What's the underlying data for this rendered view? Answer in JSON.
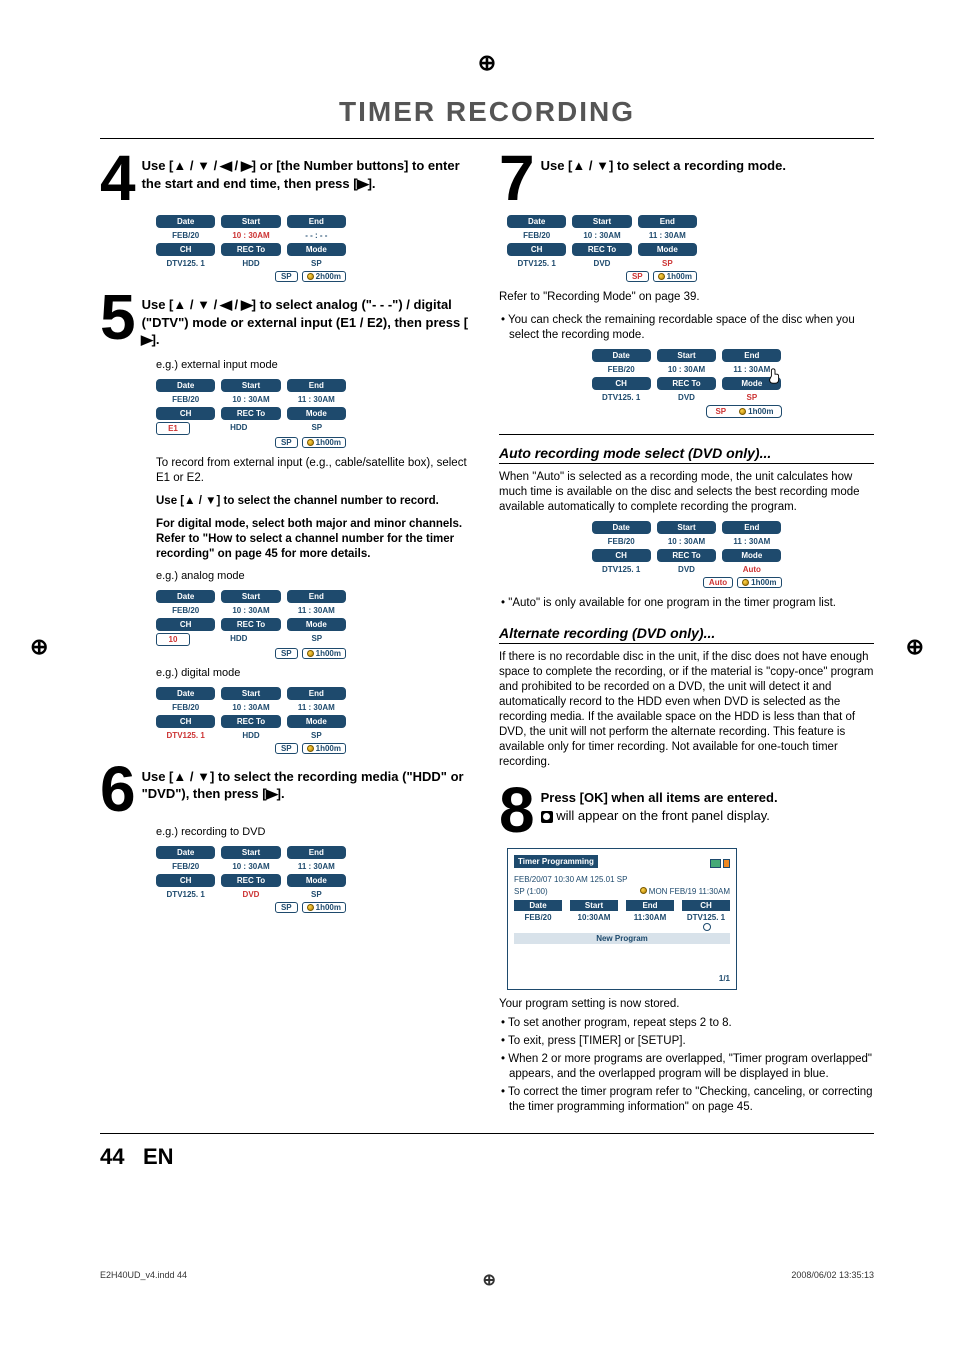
{
  "section_title": "TIMER RECORDING",
  "steps": {
    "s4": {
      "num": "4",
      "text_pre": "Use [",
      "text_mid": "] or [the Number buttons] to enter the start and end time, then press [",
      "text_post": "]."
    },
    "s5": {
      "num": "5",
      "text_pre": "Use [",
      "text_mid": "] to select analog (\"- - -\") / digital (\"DTV\") mode or external input (E1 / E2), then press [",
      "text_post": "].",
      "eg_ext": "e.g.) external input mode",
      "p1": "To record from external input (e.g., cable/satellite box), select E1 or E2.",
      "p2_pre": "Use [",
      "p2_post": "] to select the channel number to record.",
      "p3": "For digital mode, select both major and minor channels. Refer to \"How to select a channel number for the timer recording\" on page 45 for more details.",
      "eg_ana": "e.g.) analog mode",
      "eg_dig": "e.g.) digital mode"
    },
    "s6": {
      "num": "6",
      "text_pre": "Use [",
      "text_mid": "] to select the recording media (\"HDD\" or \"DVD\"), then press [",
      "text_post": "].",
      "eg": "e.g.) recording to DVD"
    },
    "s7": {
      "num": "7",
      "text_pre": "Use [",
      "text_post": "] to select a recording mode.",
      "refer": "Refer to \"Recording Mode\" on page 39.",
      "b1": "You can check the remaining recordable space of the disc when you select the recording mode."
    },
    "s8": {
      "num": "8",
      "title": "Press [OK] when all items are entered.",
      "after_icon": " will appear on the front panel display.",
      "stored": "Your program setting is now stored.",
      "b1": "To set another program, repeat steps 2 to 8.",
      "b2": "To exit, press [TIMER] or [SETUP].",
      "b3": "When 2 or more programs are overlapped, \"Timer program overlapped\" appears, and the overlapped program will be displayed in blue.",
      "b4": "To correct the timer program refer to \"Checking, canceling, or correcting the timer programming information\" on page 45."
    }
  },
  "sections": {
    "auto_head": "Auto recording mode select (DVD only)...",
    "auto_p": "When \"Auto\" is selected as a recording mode, the unit calculates how much time is available on the disc and selects the best recording mode available automatically to complete recording the program.",
    "auto_b": "\"Auto\" is only available for one program in the timer program list.",
    "alt_head": "Alternate recording (DVD only)...",
    "alt_p": "If there is no recordable disc in the unit, if the disc does not have enough space to complete the recording, or if the material is \"copy-once\" program and prohibited to be recorded on a DVD, the unit will detect it and automatically record to the HDD even when DVD is selected as the recording media. If the available space on the HDD is less than that of DVD, the unit will not perform the alternate recording. This feature is available only for timer recording. Not available for one-touch timer recording."
  },
  "labels": {
    "Date": "Date",
    "Start": "Start",
    "End": "End",
    "CH": "CH",
    "RECTo": "REC To",
    "Mode": "Mode",
    "NewProgram": "New Program",
    "TimerProgramming": "Timer Programming"
  },
  "values": {
    "FEB20": "FEB/20",
    "t1030": "10 : 30AM",
    "t1130": "11 : 30AM",
    "dashes": "- - : - -",
    "DTV125": "DTV125. 1",
    "HDD": "HDD",
    "DVD": "DVD",
    "SP": "SP",
    "h2": "2h00m",
    "h1": "1h00m",
    "E1": "E1",
    "ten": "10",
    "Auto": "Auto",
    "prog_summary": "FEB/20/07 10:30 AM 125.01 SP",
    "sp_time": "SP  (1:00)",
    "mon_date": "MON FEB/19 11:30AM",
    "list_date": "FEB/20",
    "list_start": "10:30AM",
    "list_end": "11:30AM",
    "list_ch": "DTV125. 1",
    "page_ind": "1/1"
  },
  "footer": {
    "page": "44",
    "lang": "EN",
    "file": "E2H40UD_v4.indd   44",
    "timestamp": "2008/06/02   13:35:13"
  }
}
